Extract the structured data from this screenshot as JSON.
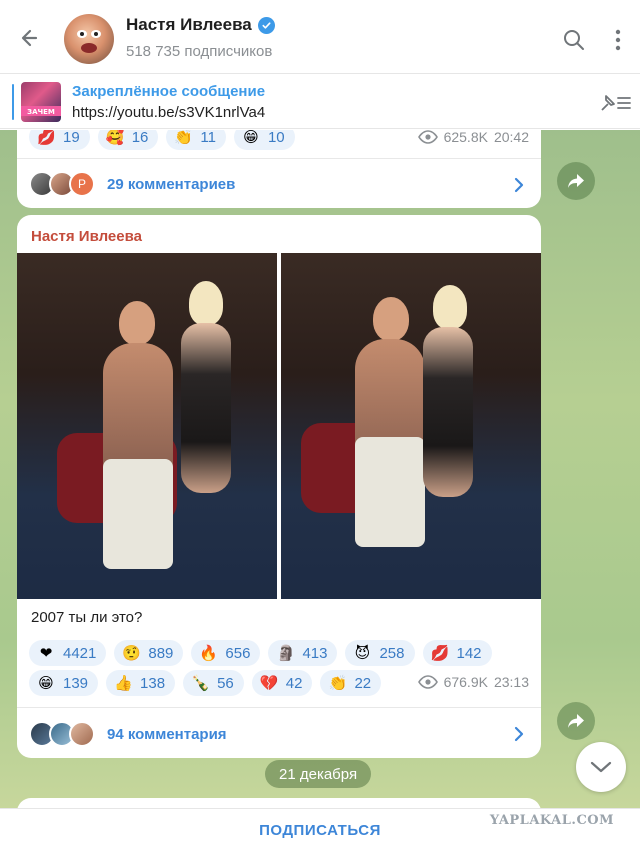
{
  "header": {
    "channel_name": "Настя Ивлеева",
    "subscribers": "518 735 подписчиков",
    "back_icon": "arrow-left-icon",
    "search_icon": "search-icon",
    "more_icon": "kebab-menu-icon"
  },
  "pinned": {
    "title": "Закреплённое сообщение",
    "text": "https://youtu.be/s3VK1nrlVa4",
    "thumb_text": "ЗАЧЕМ"
  },
  "message1": {
    "reactions": [
      {
        "icon": "💋",
        "count": "19"
      },
      {
        "icon": "🥰",
        "count": "16"
      },
      {
        "icon": "👏",
        "count": "11"
      },
      {
        "icon": "😁",
        "count": "10"
      }
    ],
    "views": "625.8K",
    "time": "20:42",
    "comments": "29 комментариев",
    "comment_avatar_letter": "P"
  },
  "message2": {
    "author": "Настя Ивлеева",
    "caption": "2007 ты ли это?",
    "reactions_row1": [
      {
        "icon": "❤",
        "count": "4421"
      },
      {
        "icon": "🤨",
        "count": "889"
      },
      {
        "icon": "🔥",
        "count": "656"
      },
      {
        "icon": "🗿",
        "count": "413"
      },
      {
        "icon": "😈",
        "count": "258"
      },
      {
        "icon": "💋",
        "count": "142"
      }
    ],
    "reactions_row2": [
      {
        "icon": "😁",
        "count": "139"
      },
      {
        "icon": "👍",
        "count": "138"
      },
      {
        "icon": "🍾",
        "count": "56"
      },
      {
        "icon": "💔",
        "count": "42"
      },
      {
        "icon": "👏",
        "count": "22"
      }
    ],
    "views": "676.9K",
    "time": "23:13",
    "comments": "94 комментария"
  },
  "date_chip": "21 декабря",
  "footer": {
    "subscribe": "ПОДПИСАТЬСЯ",
    "watermark": "YAPLAKAL.COM"
  },
  "colors": {
    "accent": "#3d9ae8",
    "link": "#3d86d8",
    "author": "#c44d3c",
    "reaction_bg": "#eaf2fb"
  }
}
